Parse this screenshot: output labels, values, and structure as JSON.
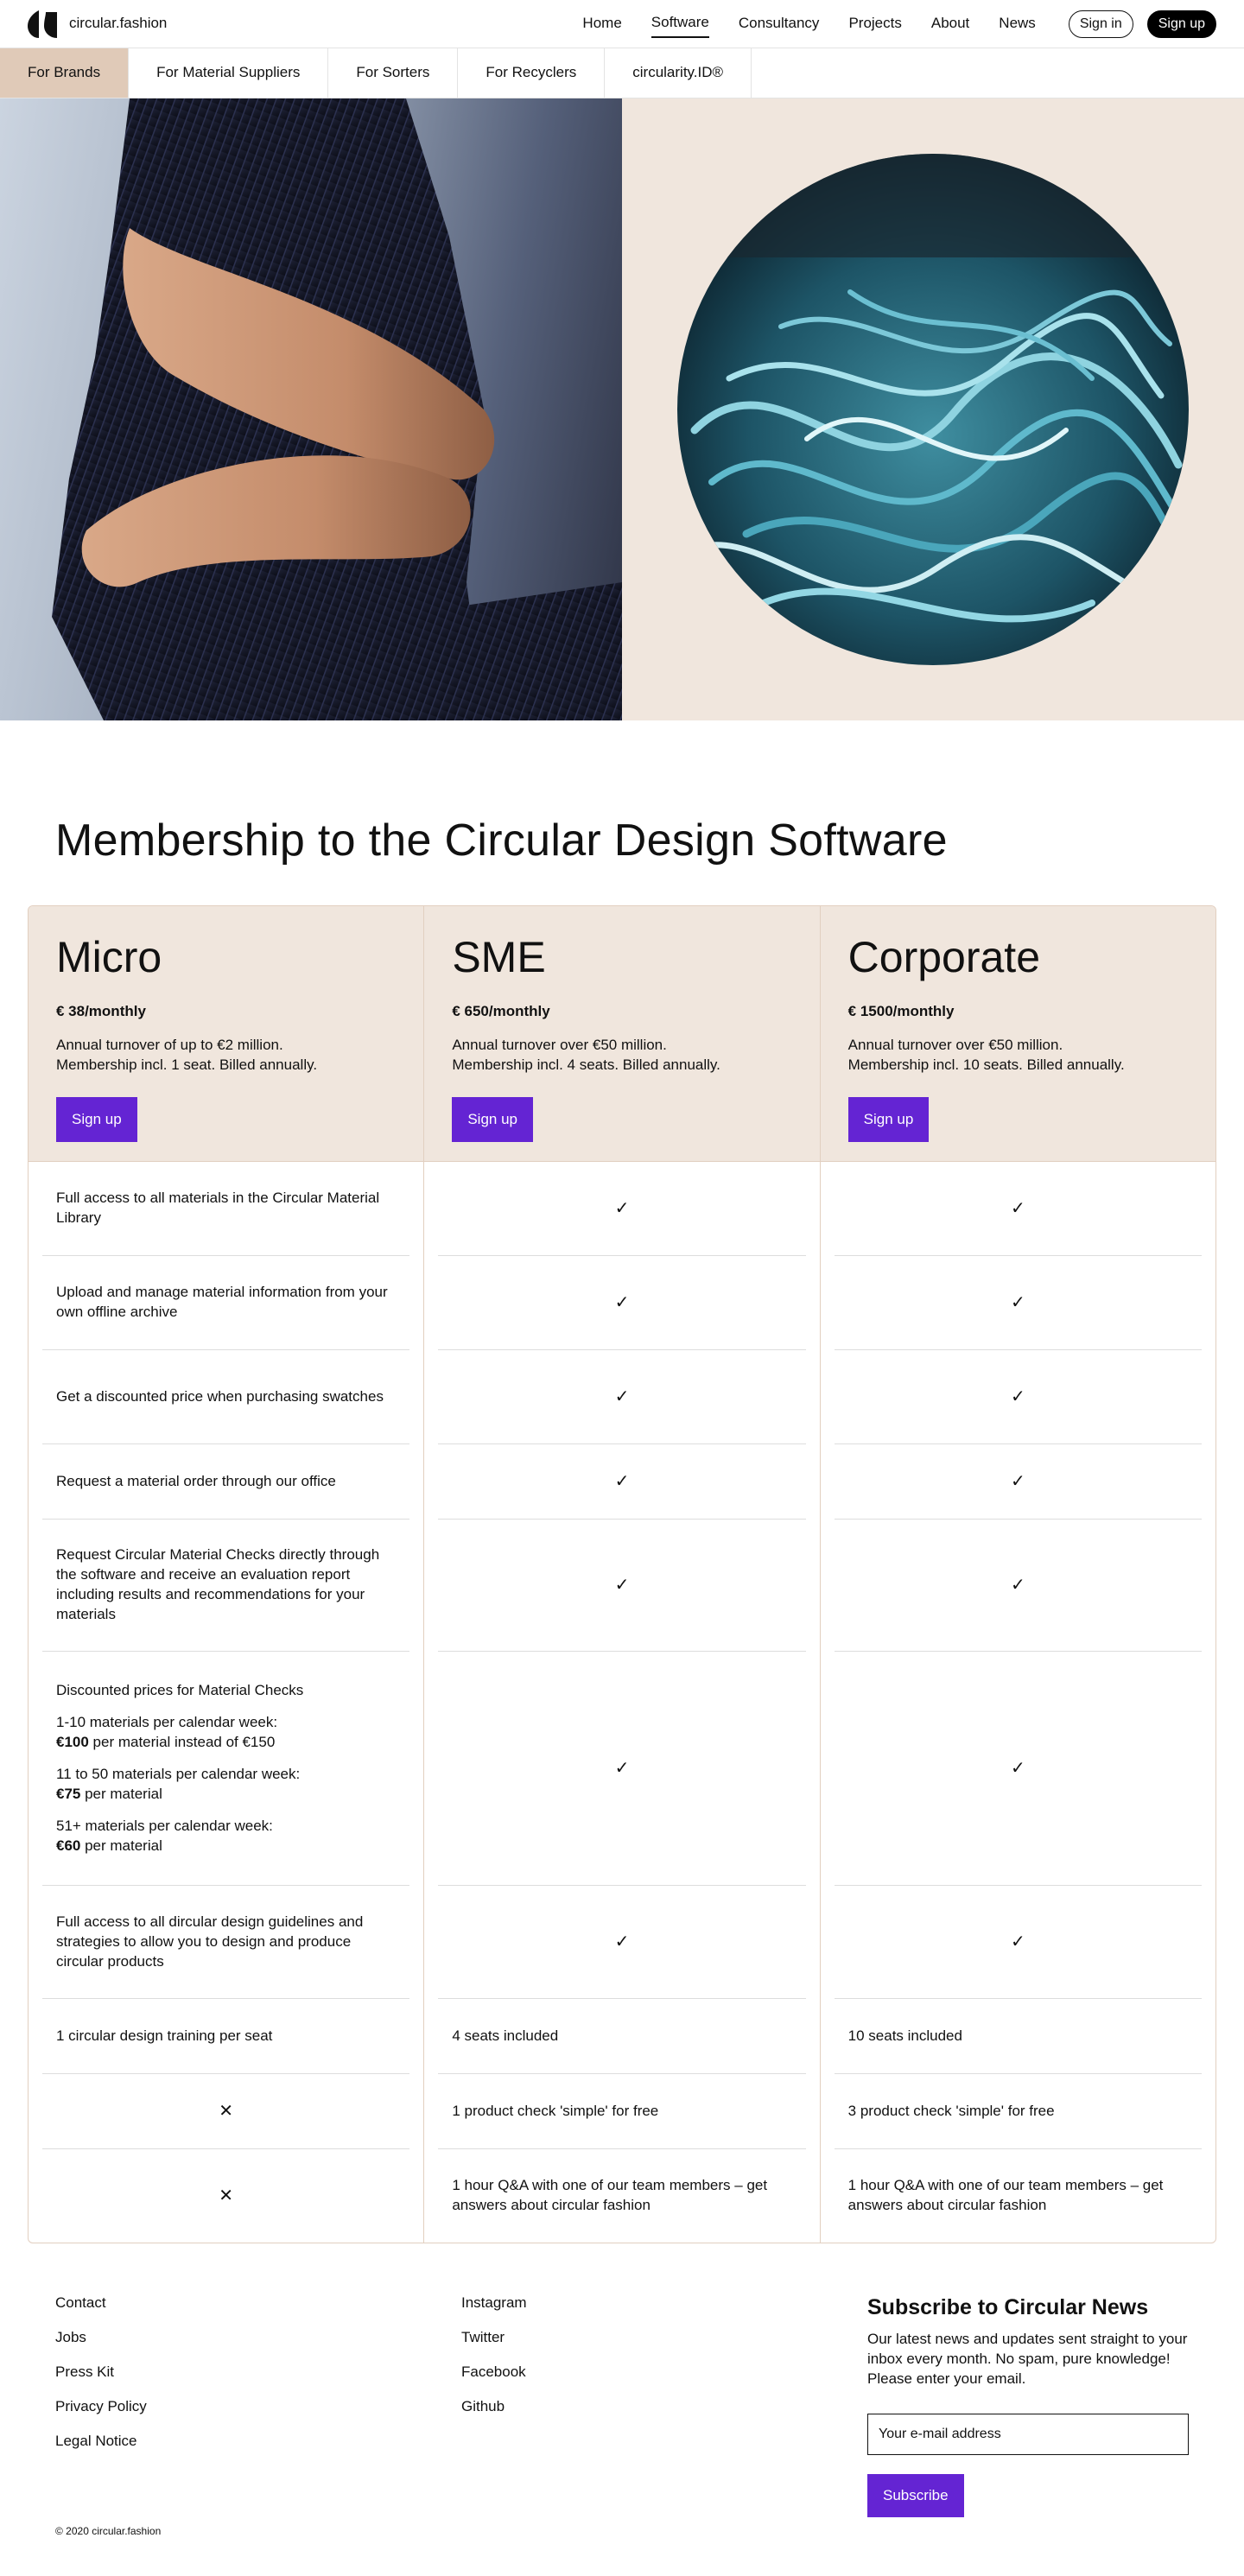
{
  "header": {
    "brand": "circular.fashion",
    "nav": [
      "Home",
      "Software",
      "Consultancy",
      "Projects",
      "About",
      "News"
    ],
    "active_nav": "Software",
    "sign_in": "Sign in",
    "sign_up": "Sign up"
  },
  "subtabs": [
    "For Brands",
    "For Material Suppliers",
    "For Sorters",
    "For Recyclers",
    "circularity.ID®"
  ],
  "pricing": {
    "title": "Membership to the Circular Design Software",
    "plans": [
      {
        "name": "Micro",
        "price": "€ 38/monthly",
        "desc1": "Annual turnover of up to €2 million.",
        "desc2": "Membership incl. 1 seat. Billed annually.",
        "cta": "Sign up"
      },
      {
        "name": "SME",
        "price": "€ 650/monthly",
        "desc1": "Annual turnover over €50 million.",
        "desc2": "Membership incl. 4 seats. Billed annually.",
        "cta": "Sign up"
      },
      {
        "name": "Corporate",
        "price": "€ 1500/monthly",
        "desc1": "Annual turnover over €50 million.",
        "desc2": "Membership incl. 10 seats. Billed annually.",
        "cta": "Sign up"
      }
    ],
    "features": {
      "f1": "Full access to all materials in the Circular Material Library",
      "f2": "Upload and manage material information from your own offline archive",
      "f3": "Get a discounted price when purchasing swatches",
      "f4": "Request a material order through our office",
      "f5": "Request Circular Material Checks directly through the software and receive an evaluation report including results and recommendations for your materials",
      "f6_title": "Discounted prices for Material Checks",
      "f6_t1": "1-10 materials per calendar week:",
      "f6_p1": "€100",
      "f6_r1": " per material instead of €150",
      "f6_t2": "11 to 50 materials per calendar week:",
      "f6_p2": "€75",
      "f6_r2": " per material",
      "f6_t3": "51+ materials per calendar week:",
      "f6_p3": "€60",
      "f6_r3": " per material",
      "f7": "Full access to all dircular design guidelines and strategies to allow you to design and produce circular products",
      "f8": "1 circular design training per seat"
    },
    "sme_rows": {
      "training": "4 seats included",
      "check": "1 product check 'simple' for free",
      "qa": "1 hour Q&A with one of our team members – get answers about circular fashion"
    },
    "corp_rows": {
      "training": "10 seats included",
      "check": "3 product check 'simple' for free",
      "qa": "1 hour Q&A with one of our team members – get answers about circular fashion"
    },
    "check_glyph": "✓",
    "cross_glyph": "✕"
  },
  "footer": {
    "col1": [
      "Contact",
      "Jobs",
      "Press Kit",
      "Privacy Policy",
      "Legal Notice"
    ],
    "col2": [
      "Instagram",
      "Twitter",
      "Facebook",
      "Github"
    ],
    "newsletter_title": "Subscribe to Circular News",
    "newsletter_text": "Our latest news and updates sent straight to your inbox every month. No spam, pure knowledge! Please enter your email.",
    "email_placeholder": "Your e-mail address",
    "subscribe": "Subscribe",
    "copyright": "© 2020 circular.fashion"
  },
  "colors": {
    "accent_purple": "#6424d3",
    "beige": "#f0e6dd",
    "active_tab": "#e0cab8"
  }
}
